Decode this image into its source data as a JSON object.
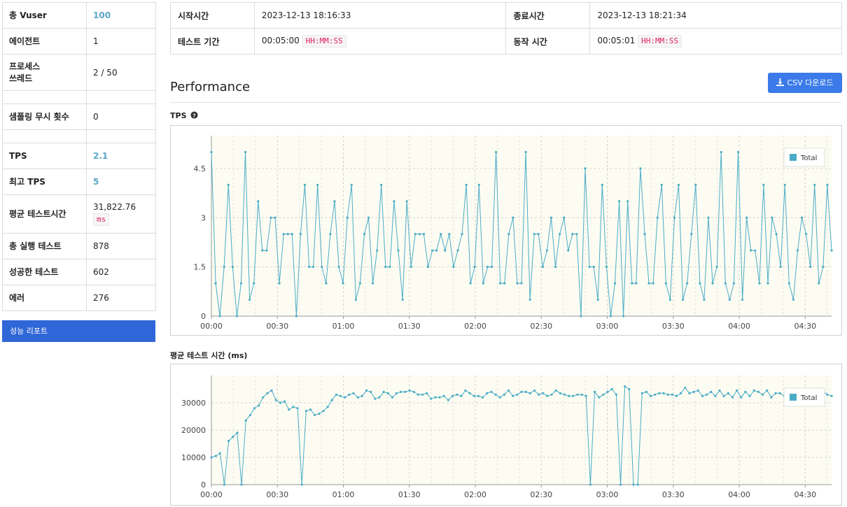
{
  "stats": [
    {
      "label": "총 Vuser",
      "value": "100",
      "accent": true
    },
    {
      "label": "에이전트",
      "value": "1"
    },
    {
      "label": "프로세스\n쓰레드",
      "value": "2 / 50"
    },
    {
      "label": "",
      "value": ""
    },
    {
      "label": "샘플링 무시 횟수",
      "value": "0"
    },
    {
      "label": "",
      "value": ""
    },
    {
      "label": "TPS",
      "value": "2.1",
      "accent": true
    },
    {
      "label": "최고 TPS",
      "value": "5",
      "accent": true
    },
    {
      "label": "평균 테스트시간",
      "value": "31,822.76",
      "unit": "ms"
    },
    {
      "label": "총 실행 테스트",
      "value": "878"
    },
    {
      "label": "성공한 테스트",
      "value": "602"
    },
    {
      "label": "에러",
      "value": "276"
    }
  ],
  "report_button": "성능 리포트",
  "times": {
    "start_label": "시작시간",
    "start_value": "2023-12-13 18:16:33",
    "end_label": "종료시간",
    "end_value": "2023-12-13 18:21:34",
    "duration_label": "테스트 기간",
    "duration_value": "00:05:00",
    "duration_format": "HH:MM:SS",
    "run_label": "동작 시간",
    "run_value": "00:05:01",
    "run_format": "HH:MM:SS"
  },
  "performance": {
    "title": "Performance",
    "csv_button": "CSV 다운로드",
    "download_icon": "download-icon"
  },
  "colors": {
    "series": "#4bacc6",
    "plot_bg": "#fcfcf2",
    "accent": "#5aa6c7",
    "button": "#3b7ae8"
  },
  "chart_data": [
    {
      "type": "line",
      "title": "TPS",
      "help_icon": "question-circle-icon",
      "x_ticks": [
        "00:00",
        "00:30",
        "01:00",
        "01:30",
        "02:00",
        "02:30",
        "03:00",
        "03:30",
        "04:00",
        "04:30"
      ],
      "ylim": [
        0,
        5.5
      ],
      "y_ticks": [
        0,
        1.5,
        3,
        4.5
      ],
      "grid": true,
      "legend": "top-right",
      "series": [
        {
          "name": "Total",
          "values": [
            5,
            1,
            0,
            1.5,
            4,
            1.5,
            0,
            1,
            5,
            0.5,
            1,
            3.5,
            2,
            2,
            3,
            3,
            1,
            2.5,
            2.5,
            2.5,
            0,
            2.5,
            4,
            1.5,
            1.5,
            4,
            1.5,
            1,
            2.5,
            3.5,
            1.5,
            1,
            3,
            4,
            0.5,
            1,
            2.5,
            3,
            1,
            2,
            4,
            1.5,
            1.5,
            3.5,
            2,
            0.5,
            3.5,
            1.5,
            2.5,
            2.5,
            2.5,
            1.5,
            2,
            2,
            2.5,
            2,
            2.5,
            1.5,
            2,
            2.5,
            4,
            1,
            1.5,
            4,
            1,
            1.5,
            1.5,
            5,
            1,
            1,
            2.5,
            3,
            1,
            1,
            5,
            0.5,
            2.5,
            2.5,
            1.5,
            2,
            3,
            1.5,
            2.5,
            3,
            2,
            2.5,
            2.5,
            0,
            4.5,
            1.5,
            1.5,
            0.5,
            4,
            1.5,
            0,
            1,
            3.5,
            0,
            3.5,
            1,
            1,
            4.5,
            2.5,
            1,
            1,
            3,
            4,
            1,
            0.5,
            3,
            4,
            0.5,
            1,
            2.5,
            4,
            1,
            0.5,
            3,
            1,
            1.5,
            5,
            1,
            0.5,
            1,
            5,
            0.5,
            3,
            2,
            2,
            1,
            4,
            1,
            3,
            2.5,
            1.5,
            4,
            1,
            0.5,
            2,
            3,
            2.5,
            1.5,
            4,
            1,
            1.5,
            4,
            2
          ]
        }
      ]
    },
    {
      "type": "line",
      "title": "평균 테스트 시간 (ms)",
      "x_ticks": [
        "00:00",
        "00:30",
        "01:00",
        "01:30",
        "02:00",
        "02:30",
        "03:00",
        "03:30",
        "04:00",
        "04:30"
      ],
      "ylim": [
        0,
        40000
      ],
      "y_ticks": [
        0,
        10000,
        20000,
        30000
      ],
      "grid": true,
      "legend": "top-right",
      "series": [
        {
          "name": "Total",
          "values": [
            10000,
            10500,
            11500,
            0,
            16000,
            17500,
            19000,
            0,
            23500,
            25500,
            28000,
            29000,
            32000,
            33500,
            34500,
            31000,
            30000,
            30500,
            27500,
            28500,
            28000,
            0,
            27000,
            27500,
            25500,
            26000,
            27000,
            28500,
            31000,
            33000,
            32500,
            32000,
            33000,
            33500,
            32000,
            32500,
            34500,
            34000,
            31500,
            32000,
            34000,
            33500,
            32000,
            33500,
            34000,
            34000,
            34500,
            34000,
            33000,
            33000,
            33500,
            31500,
            32000,
            32000,
            32500,
            31000,
            32500,
            33000,
            32500,
            34500,
            33500,
            32500,
            32500,
            32000,
            33500,
            34000,
            33000,
            32000,
            33000,
            34500,
            32500,
            33000,
            34000,
            34000,
            33500,
            34500,
            33000,
            33500,
            32500,
            33000,
            34500,
            33500,
            33000,
            32500,
            32500,
            33000,
            33000,
            32500,
            0,
            34000,
            32000,
            33000,
            34000,
            35000,
            33000,
            0,
            36000,
            35000,
            0,
            0,
            33500,
            34000,
            32500,
            33000,
            33500,
            33500,
            33000,
            33000,
            32500,
            33500,
            35500,
            33500,
            34000,
            34500,
            32500,
            33000,
            34000,
            32500,
            34500,
            32500,
            33500,
            32000,
            34500,
            32000,
            34000,
            32500,
            34500,
            34000,
            33000,
            34500,
            32000,
            33500,
            33500,
            32500,
            33000,
            34000,
            33000,
            33500,
            32000,
            33500,
            34500,
            33000,
            34500,
            33000,
            32500
          ]
        }
      ]
    }
  ]
}
